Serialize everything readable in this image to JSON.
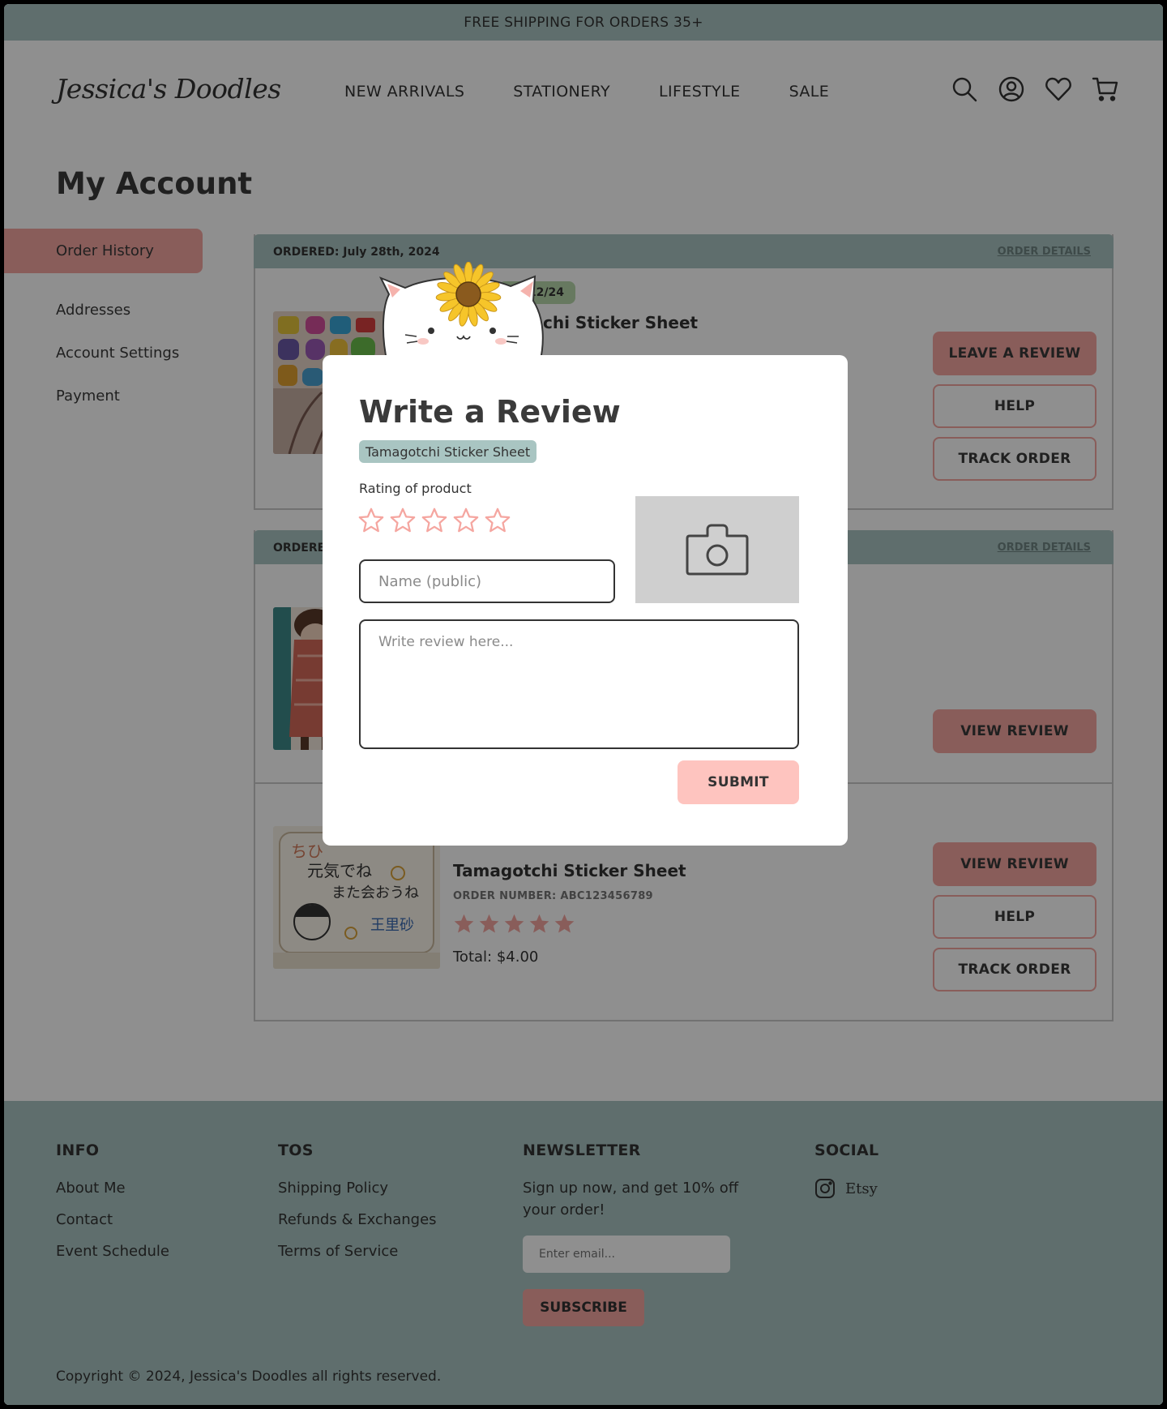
{
  "topbar": {
    "text": "FREE SHIPPING FOR ORDERS 35+"
  },
  "header": {
    "logo": "Jessica's Doodles",
    "nav": [
      "NEW ARRIVALS",
      "STATIONERY",
      "LIFESTYLE",
      "SALE"
    ],
    "icons": [
      "search-icon",
      "account-icon",
      "heart-icon",
      "cart-icon"
    ]
  },
  "page": {
    "title": "My Account"
  },
  "sidebar": {
    "items": [
      {
        "label": "Order History",
        "active": true
      },
      {
        "label": "Addresses"
      },
      {
        "label": "Account Settings"
      },
      {
        "label": "Payment"
      }
    ]
  },
  "orders": [
    {
      "ordered_label": "ORDERED: July 28th, 2024",
      "details_link": "ORDER DETAILS",
      "badge": "8/12/24",
      "product_name": "chi Sticker Sheet",
      "buttons": {
        "review": "LEAVE A REVIEW",
        "help": "HELP",
        "track": "TRACK ORDER"
      }
    },
    {
      "ordered_label": "ORDERED",
      "details_link": "ORDER DETAILS",
      "buttons": {
        "review": "VIEW REVIEW"
      }
    },
    {
      "product_name": "Tamagotchi Sticker Sheet",
      "order_number": "ORDER NUMBER: ABC123456789",
      "rating": 5,
      "total": "Total: $4.00",
      "buttons": {
        "review": "VIEW REVIEW",
        "help": "HELP",
        "track": "TRACK ORDER"
      }
    }
  ],
  "footer": {
    "info": {
      "heading": "INFO",
      "links": [
        "About Me",
        "Contact",
        "Event Schedule"
      ]
    },
    "tos": {
      "heading": "TOS",
      "links": [
        "Shipping Policy",
        "Refunds & Exchanges",
        "Terms of Service"
      ]
    },
    "newsletter": {
      "heading": "NEWSLETTER",
      "text": "Sign up now, and get 10% off your order!",
      "placeholder": "Enter email...",
      "button": "SUBSCRIBE"
    },
    "social": {
      "heading": "SOCIAL",
      "etsy": "Etsy"
    },
    "copyright": "Copyright © 2024, Jessica's Doodles all rights reserved."
  },
  "modal": {
    "title": "Write a Review",
    "product_tag": "Tamagotchi Sticker Sheet",
    "rating_label": "Rating of product",
    "rating_value": 0,
    "rating_max": 5,
    "name_placeholder": "Name (public)",
    "review_placeholder": "Write review here...",
    "submit": "SUBMIT",
    "photo_icon": "camera-icon"
  },
  "colors": {
    "accent_pink": "#f5a6a0",
    "light_pink": "#fec4bf",
    "teal": "#a9c5c2",
    "green_badge": "#b8d8ac",
    "overlay": "rgba(0,0,0,0.44)"
  }
}
